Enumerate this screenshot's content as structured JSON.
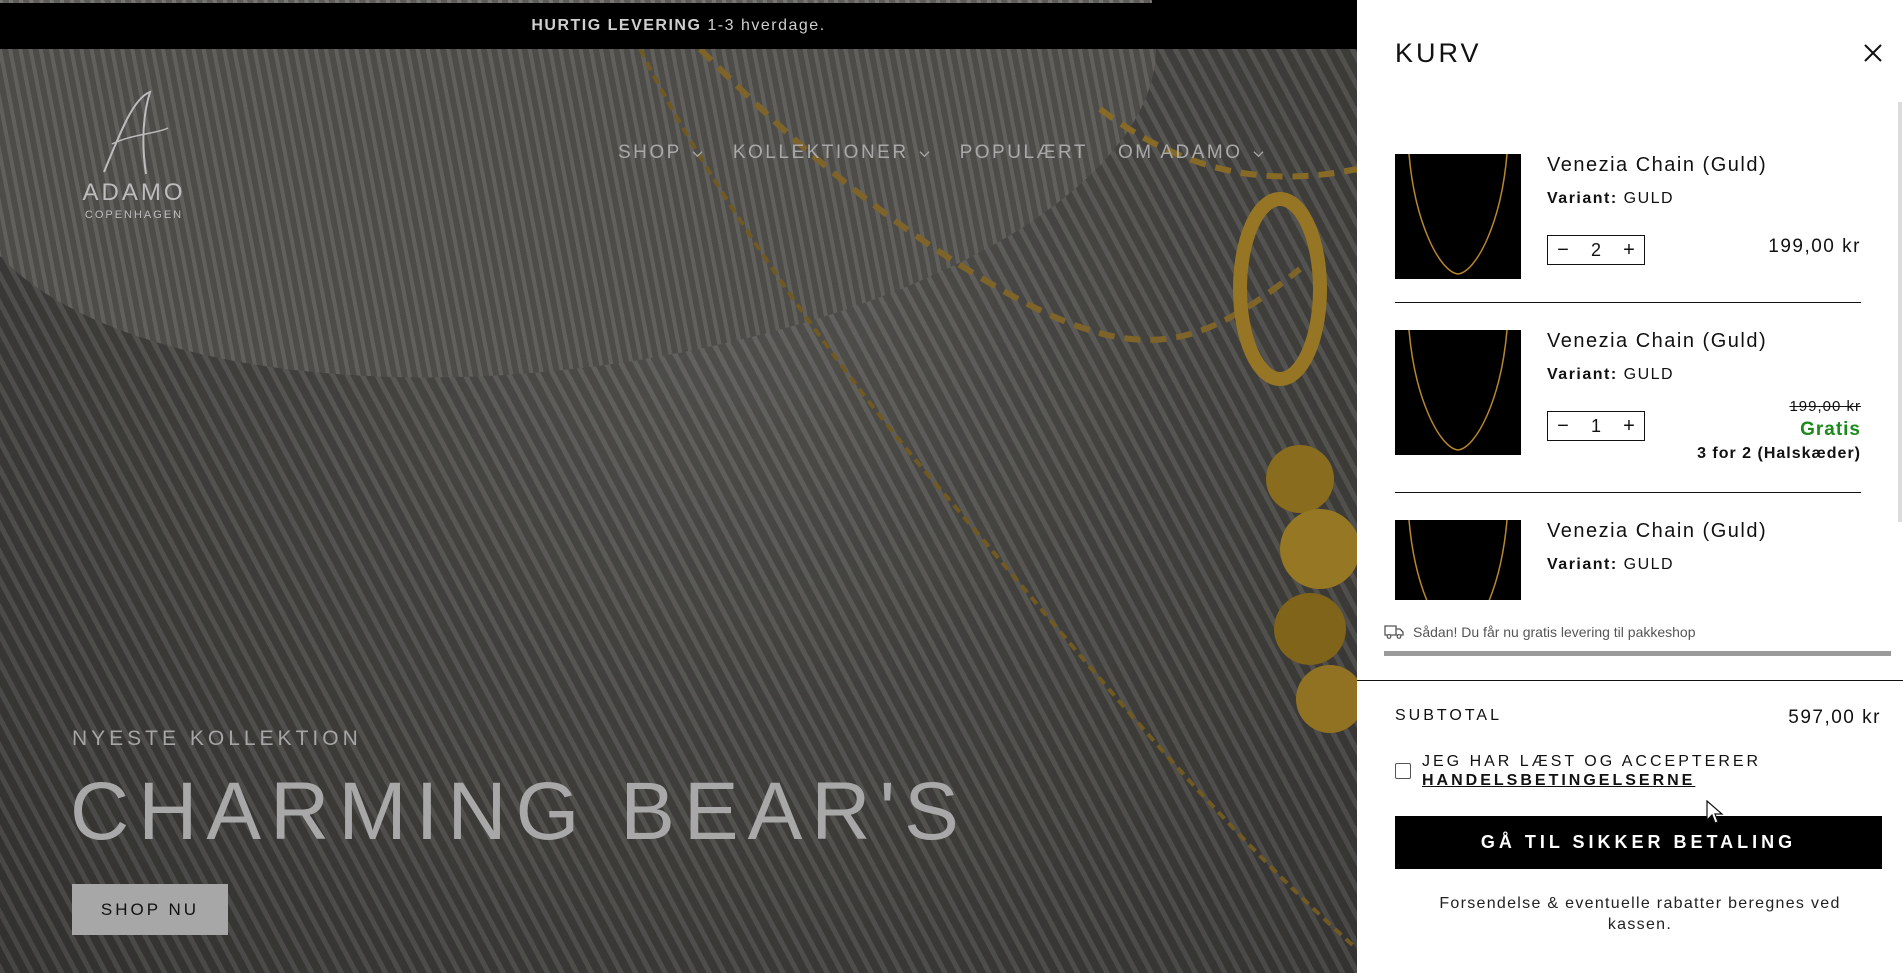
{
  "announcement": {
    "bold": "HURTIG LEVERING",
    "rest": "1-3 hverdage."
  },
  "logo": {
    "name": "ADAMO",
    "sub": "COPENHAGEN"
  },
  "nav": [
    {
      "label": "SHOP",
      "dropdown": true
    },
    {
      "label": "KOLLEKTIONER",
      "dropdown": true
    },
    {
      "label": "POPULÆRT",
      "dropdown": false
    },
    {
      "label": "OM ADAMO",
      "dropdown": true
    }
  ],
  "hero": {
    "eyebrow": "NYESTE KOLLEKTION",
    "title": "CHARMING BEAR'S",
    "button": "SHOP NU"
  },
  "cart": {
    "title": "KURV",
    "variant_label": "Variant:",
    "items": [
      {
        "title": "Venezia Chain (Guld)",
        "variant": "GULD",
        "qty": "2",
        "price": "199,00 kr"
      },
      {
        "title": "Venezia Chain (Guld)",
        "variant": "GULD",
        "qty": "1",
        "original_price": "199,00 kr",
        "discount_label": "Gratis",
        "promo": "3 for 2 (Halskæder)"
      },
      {
        "title": "Venezia Chain (Guld)",
        "variant": "GULD"
      }
    ],
    "shipping_note": "Sådan! Du får nu gratis levering til pakkeshop",
    "shipping_progress": 1.0,
    "subtotal_label": "SUBTOTAL",
    "subtotal_value": "597,00 kr",
    "terms_text": "JEG HAR LÆST OG ACCEPTERER",
    "terms_link": "HANDELSBETINGELSERNE",
    "checkout_label": "GÅ TIL SIKKER BETALING",
    "shipping_info": "Forsendelse & eventuelle rabatter beregnes ved kassen."
  },
  "colors": {
    "accent_free": "#1b8a1b",
    "checkout_bg": "#000000"
  }
}
